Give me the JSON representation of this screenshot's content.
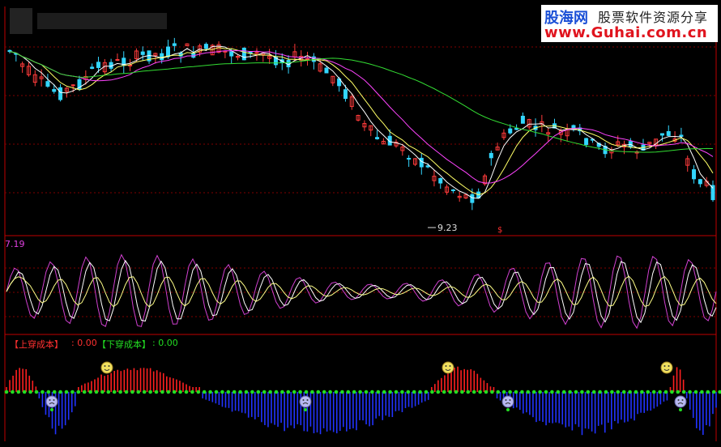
{
  "watermark": {
    "brand": "股海网",
    "slogan": "股票软件资源分享",
    "url": "www.Guhai.com.cn"
  },
  "colors": {
    "up": "#ff3b3b",
    "down": "#33d6ff",
    "ma5": "#ffffff",
    "ma10": "#ffff66",
    "ma20": "#ff44ff",
    "ma60": "#33dd33",
    "hist_up": "#ff2020",
    "hist_down": "#2233ff",
    "axis": "#c00000",
    "zero_line": "#22dd22"
  },
  "price_panel": {
    "low_label": "9.23",
    "marker": "$"
  },
  "osc_panel": {
    "value_label": "7.19"
  },
  "cost_panel": {
    "up_label": "【上穿成本】",
    "up_value": ": 0.00",
    "down_label": "【下穿成本】",
    "down_value": ": 0.00"
  },
  "chart_data": {
    "type": "candlestick",
    "xlabel": "",
    "ylabel": "",
    "trend_y": [
      0.1,
      0.12,
      0.18,
      0.22,
      0.26,
      0.28,
      0.3,
      0.32,
      0.33,
      0.32,
      0.3,
      0.28,
      0.25,
      0.22,
      0.2,
      0.18,
      0.17,
      0.17,
      0.16,
      0.15,
      0.14,
      0.13,
      0.12,
      0.12,
      0.12,
      0.11,
      0.1,
      0.1,
      0.1,
      0.11,
      0.11,
      0.1,
      0.1,
      0.1,
      0.11,
      0.11,
      0.12,
      0.12,
      0.13,
      0.12,
      0.12,
      0.13,
      0.14,
      0.15,
      0.15,
      0.14,
      0.14,
      0.15,
      0.17,
      0.2,
      0.22,
      0.24,
      0.28,
      0.33,
      0.38,
      0.45,
      0.52,
      0.55,
      0.58,
      0.62,
      0.6,
      0.62,
      0.63,
      0.66,
      0.7,
      0.72,
      0.75,
      0.78,
      0.82,
      0.84,
      0.86,
      0.88,
      0.9,
      0.9,
      0.88,
      0.8,
      0.7,
      0.62,
      0.58,
      0.55,
      0.52,
      0.5,
      0.51,
      0.52,
      0.53,
      0.53,
      0.54,
      0.55,
      0.56,
      0.55,
      0.56,
      0.58,
      0.62,
      0.64,
      0.64,
      0.63,
      0.62,
      0.62,
      0.63,
      0.64,
      0.65,
      0.62,
      0.6,
      0.56,
      0.55,
      0.56,
      0.58,
      0.7,
      0.78,
      0.82,
      0.85,
      0.88
    ],
    "osc_cycles": 20,
    "cost_hist": {
      "up_segments": [
        [
          0,
          10
        ],
        [
          22,
          60
        ],
        [
          130,
          150
        ],
        [
          203,
          208
        ]
      ],
      "down_segments": [
        [
          10,
          22
        ],
        [
          60,
          130
        ],
        [
          150,
          203
        ],
        [
          208,
          218
        ]
      ]
    }
  }
}
